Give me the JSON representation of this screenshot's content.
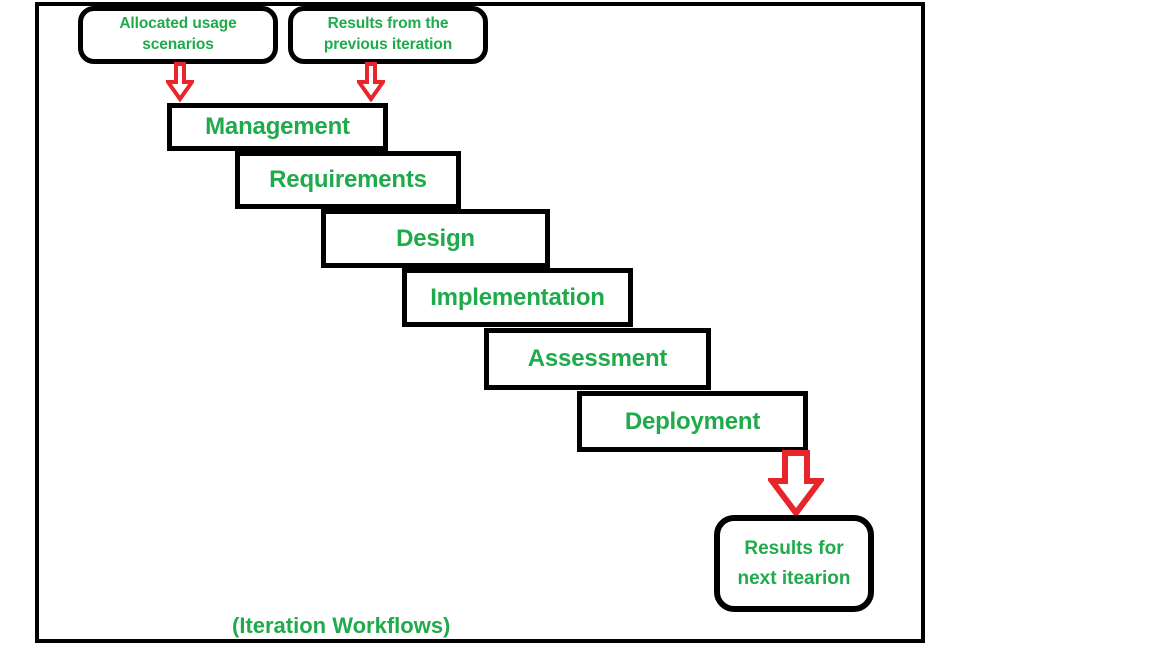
{
  "diagram": {
    "caption": "(Iteration Workflows)",
    "colors": {
      "text_green": "#1faa4b",
      "outline_black": "#000000",
      "arrow_red": "#e8252a",
      "fill_white": "#ffffff"
    },
    "inputs": [
      {
        "id": "allocated-usage-scenarios",
        "line1": "Allocated usage",
        "line2": "scenarios"
      },
      {
        "id": "results-previous-iteration",
        "line1": "Results from the",
        "line2": "previous iteration"
      }
    ],
    "phases": [
      {
        "id": "management",
        "label": "Management"
      },
      {
        "id": "requirements",
        "label": "Requirements"
      },
      {
        "id": "design",
        "label": "Design"
      },
      {
        "id": "implementation",
        "label": "Implementation"
      },
      {
        "id": "assessment",
        "label": "Assessment"
      },
      {
        "id": "deployment",
        "label": "Deployment"
      }
    ],
    "output": {
      "id": "results-next-iteration",
      "line1": "Results for",
      "line2": "next itearion"
    },
    "arrows": [
      {
        "id": "arrow-to-management-left",
        "direction": "down"
      },
      {
        "id": "arrow-to-management-right",
        "direction": "down"
      },
      {
        "id": "arrow-to-results",
        "direction": "down"
      }
    ]
  }
}
